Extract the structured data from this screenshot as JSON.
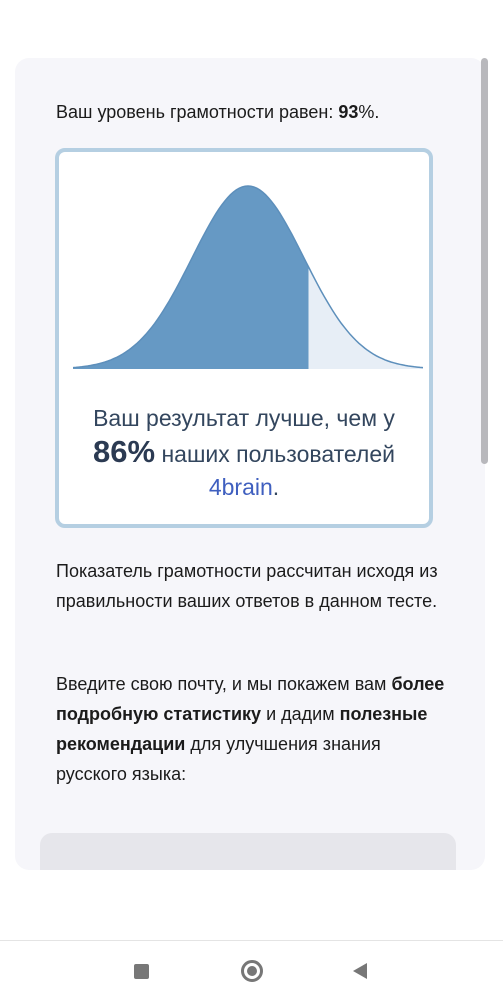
{
  "level": {
    "prefix": "Ваш уровень грамотности равен: ",
    "value": "93",
    "suffix": "%."
  },
  "result": {
    "line1": "Ваш результат лучше, чем у",
    "percent": "86%",
    "line2_rest": " наших пользователей",
    "brand": "4brain",
    "end": ".",
    "better_than_fraction": 0.86
  },
  "info_text": "Показатель грамотности рассчитан исходя из правильности ваших ответов в данном тесте.",
  "prompt": {
    "p1": "Введите свою почту, и мы покажем вам ",
    "b1": "более подробную статистику",
    "p2": " и дадим ",
    "b2": "полезные рекомендации",
    "p3": " для улучшения знания русского языка:"
  },
  "colors": {
    "curve_fill": "#6699c4",
    "curve_tail": "#e7eef6",
    "curve_line": "#5d8fbb",
    "box_border": "#b5cfe2",
    "brand": "#3f5fbf"
  },
  "nav": {
    "recents_icon": "square-icon",
    "home_icon": "circle-icon",
    "back_icon": "triangle-back-icon"
  }
}
